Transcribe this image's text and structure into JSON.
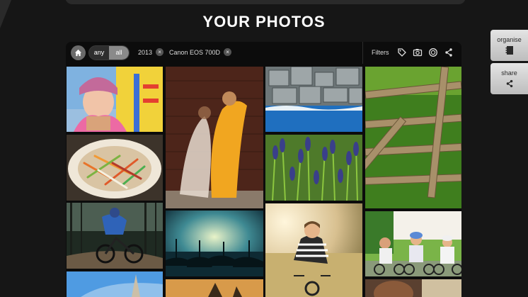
{
  "page": {
    "title": "YOUR PHOTOS"
  },
  "filter_bar": {
    "toggle": {
      "any_label": "any",
      "all_label": "all",
      "selected": "all"
    },
    "chips": [
      {
        "label": "2013"
      },
      {
        "label": "Canon EOS 700D"
      }
    ],
    "filters_label": "Filters",
    "icons": [
      "home-icon",
      "tag-icon",
      "camera-icon",
      "lens-icon",
      "share-icon"
    ]
  },
  "side_buttons": {
    "organise_label": "organise",
    "share_label": "share"
  },
  "photos": [
    {
      "name": "photo-girl-playground"
    },
    {
      "name": "photo-dancers-motion"
    },
    {
      "name": "photo-breakwater-rocks"
    },
    {
      "name": "photo-wooden-fence"
    },
    {
      "name": "photo-salad-bowl"
    },
    {
      "name": "photo-lavender-field"
    },
    {
      "name": "photo-mountain-biker"
    },
    {
      "name": "photo-gondolas"
    },
    {
      "name": "photo-boy-bike"
    },
    {
      "name": "photo-family-cycling"
    },
    {
      "name": "photo-church-tower"
    },
    {
      "name": "photo-sunset-trees"
    },
    {
      "name": "photo-portrait-partial"
    }
  ],
  "colors": {
    "background": "#161616",
    "panel": "#0c0c0c",
    "side_button": "#d4d4d4"
  }
}
